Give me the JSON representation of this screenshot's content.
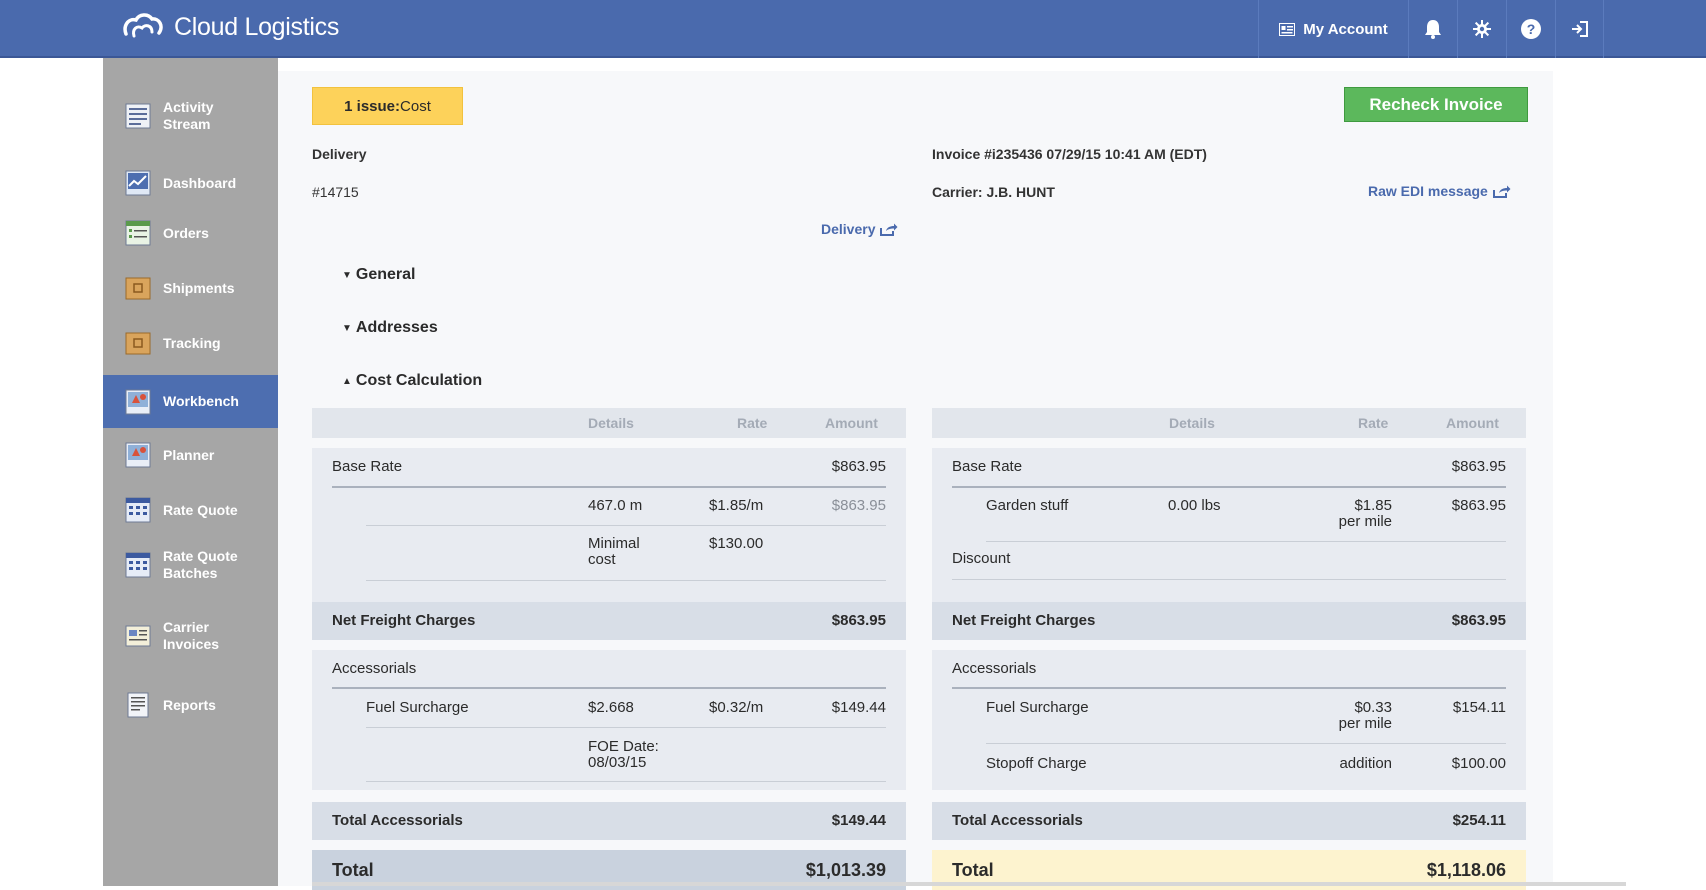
{
  "app": {
    "title": "Cloud Logistics"
  },
  "topnav": {
    "account": "My Account",
    "icons": [
      "bell-icon",
      "gear-icon",
      "help-icon",
      "logout-icon"
    ]
  },
  "sidebar": {
    "items": [
      {
        "label": "Activity\nStream",
        "icon": "activity-stream-icon"
      },
      {
        "label": "Dashboard",
        "icon": "dashboard-icon"
      },
      {
        "label": "Orders",
        "icon": "orders-icon"
      },
      {
        "label": "Shipments",
        "icon": "shipments-icon"
      },
      {
        "label": "Tracking",
        "icon": "tracking-icon"
      },
      {
        "label": "Workbench",
        "icon": "workbench-icon",
        "active": true
      },
      {
        "label": "Planner",
        "icon": "planner-icon"
      },
      {
        "label": "Rate Quote",
        "icon": "rate-quote-icon"
      },
      {
        "label": "Rate Quote\nBatches",
        "icon": "rate-quote-batches-icon"
      },
      {
        "label": "Carrier\nInvoices",
        "icon": "carrier-invoices-icon"
      },
      {
        "label": "Reports",
        "icon": "reports-icon"
      }
    ]
  },
  "header": {
    "issue_count": "1 issue:",
    "issue_type": "Cost",
    "recheck_label": "Recheck Invoice",
    "delivery_label": "Delivery",
    "delivery_number": "#14715",
    "invoice": "Invoice #i235436 07/29/15 10:41 AM (EDT)",
    "carrier": "Carrier: J.B. HUNT",
    "raw_edi": "Raw EDI message",
    "delivery_link": "Delivery"
  },
  "sections": {
    "general": "General",
    "addresses": "Addresses",
    "cost_calculation": "Cost Calculation"
  },
  "columns": {
    "details": "Details",
    "rate": "Rate",
    "amount": "Amount"
  },
  "left": {
    "base_rate": {
      "label": "Base Rate",
      "amount": "$863.95"
    },
    "base_lines": [
      {
        "details": "467.0 m",
        "rate": "$1.85/m",
        "amount": "$863.95"
      },
      {
        "details": "Minimal\ncost",
        "rate": "$130.00",
        "amount": ""
      }
    ],
    "net_freight": {
      "label": "Net Freight Charges",
      "amount": "$863.95"
    },
    "accessorials": {
      "label": "Accessorials"
    },
    "acc_lines": [
      {
        "name": "Fuel Surcharge",
        "details": "$2.668",
        "rate": "$0.32/m",
        "amount": "$149.44"
      },
      {
        "name": "",
        "details": "FOE Date:\n08/03/15",
        "rate": "",
        "amount": ""
      }
    ],
    "total_accessorials": {
      "label": "Total Accessorials",
      "amount": "$149.44"
    },
    "total": {
      "label": "Total",
      "amount": "$1,013.39"
    }
  },
  "right": {
    "base_rate": {
      "label": "Base Rate",
      "amount": "$863.95"
    },
    "base_lines": [
      {
        "name": "Garden stuff",
        "details": "0.00 lbs",
        "rate": "$1.85\nper mile",
        "amount": "$863.95"
      }
    ],
    "discount": "Discount",
    "net_freight": {
      "label": "Net Freight Charges",
      "amount": "$863.95"
    },
    "accessorials": {
      "label": "Accessorials"
    },
    "acc_lines": [
      {
        "name": "Fuel Surcharge",
        "rate": "$0.33\nper mile",
        "amount": "$154.11"
      },
      {
        "name": "Stopoff Charge",
        "rate": "addition",
        "amount": "$100.00"
      }
    ],
    "total_accessorials": {
      "label": "Total Accessorials",
      "amount": "$254.11"
    },
    "total": {
      "label": "Total",
      "amount": "$1,118.06"
    }
  },
  "colors": {
    "topbar": "#4a6aad",
    "sidebar": "#a6a6a6",
    "active": "#4d6eb0",
    "issue": "#fdd25a",
    "recheck": "#5cb85c",
    "total_right": "#fdf3cf",
    "total_left": "#c9d2de"
  }
}
